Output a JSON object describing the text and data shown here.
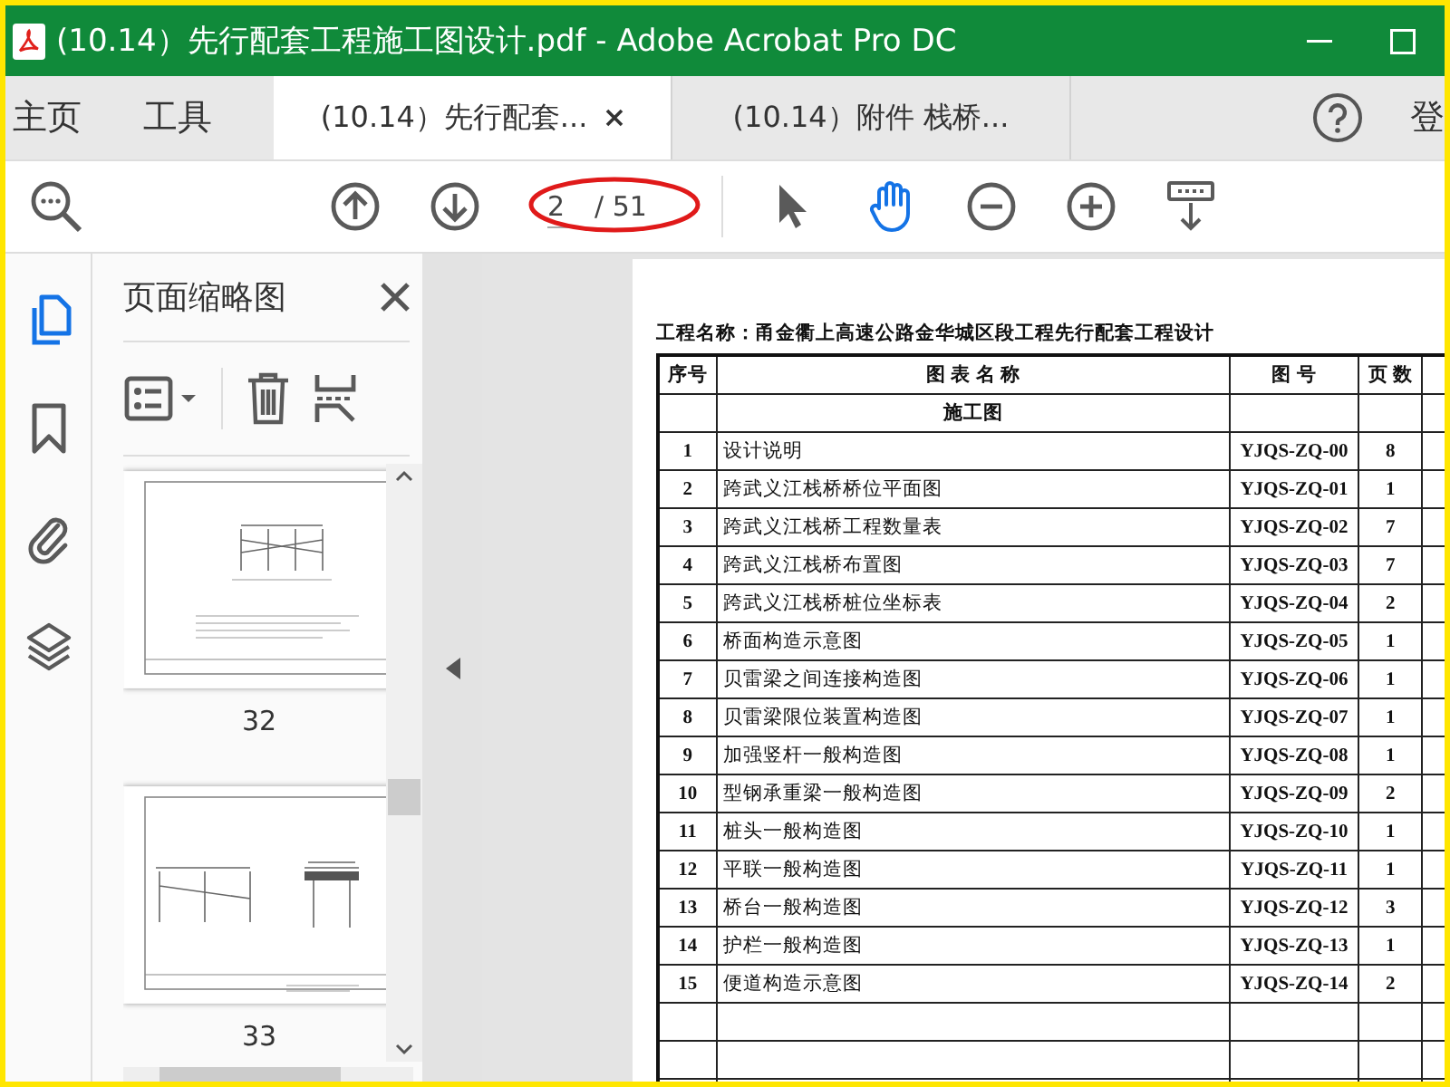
{
  "window": {
    "title": "(10.14）先行配套工程施工图设计.pdf - Adobe Acrobat Pro DC"
  },
  "nav_tabs": [
    {
      "label": "主页"
    },
    {
      "label": "工具"
    }
  ],
  "doc_tabs": [
    {
      "label": "(10.14）先行配套...",
      "selected": true
    },
    {
      "label": "(10.14）附件 栈桥...",
      "selected": false
    }
  ],
  "account_label": "登",
  "toolbar": {
    "page_value": "2",
    "page_total": "/ 51",
    "tools": [
      {
        "kind": "pointer",
        "selected": false
      },
      {
        "kind": "hand",
        "selected": true
      },
      {
        "kind": "zoom-out",
        "selected": false
      },
      {
        "kind": "zoom-in",
        "selected": false
      },
      {
        "kind": "keyboard",
        "selected": false
      }
    ]
  },
  "rail": [
    {
      "kind": "pages",
      "selected": true
    },
    {
      "kind": "bookmark",
      "selected": false
    },
    {
      "kind": "attachment",
      "selected": false
    },
    {
      "kind": "layers",
      "selected": false
    }
  ],
  "thumbnails": {
    "title": "页面缩略图",
    "pages": [
      {
        "label": "32"
      },
      {
        "label": "33"
      }
    ]
  },
  "document": {
    "project": "工程名称：甬金衢上高速公路金华城区段工程先行配套工程设计",
    "columns": [
      "序号",
      "图 表 名 称",
      "图 号",
      "页 数"
    ],
    "section": "施工图",
    "rows": [
      {
        "no": "1",
        "name": "设计说明",
        "code": "YJQS-ZQ-00",
        "pages": "8"
      },
      {
        "no": "2",
        "name": "跨武义江栈桥桥位平面图",
        "code": "YJQS-ZQ-01",
        "pages": "1"
      },
      {
        "no": "3",
        "name": "跨武义江栈桥工程数量表",
        "code": "YJQS-ZQ-02",
        "pages": "7"
      },
      {
        "no": "4",
        "name": "跨武义江栈桥布置图",
        "code": "YJQS-ZQ-03",
        "pages": "7"
      },
      {
        "no": "5",
        "name": "跨武义江栈桥桩位坐标表",
        "code": "YJQS-ZQ-04",
        "pages": "2"
      },
      {
        "no": "6",
        "name": "桥面构造示意图",
        "code": "YJQS-ZQ-05",
        "pages": "1"
      },
      {
        "no": "7",
        "name": "贝雷梁之间连接构造图",
        "code": "YJQS-ZQ-06",
        "pages": "1"
      },
      {
        "no": "8",
        "name": "贝雷梁限位装置构造图",
        "code": "YJQS-ZQ-07",
        "pages": "1"
      },
      {
        "no": "9",
        "name": "加强竖杆一般构造图",
        "code": "YJQS-ZQ-08",
        "pages": "1"
      },
      {
        "no": "10",
        "name": "型钢承重梁一般构造图",
        "code": "YJQS-ZQ-09",
        "pages": "2"
      },
      {
        "no": "11",
        "name": "桩头一般构造图",
        "code": "YJQS-ZQ-10",
        "pages": "1"
      },
      {
        "no": "12",
        "name": "平联一般构造图",
        "code": "YJQS-ZQ-11",
        "pages": "1"
      },
      {
        "no": "13",
        "name": "桥台一般构造图",
        "code": "YJQS-ZQ-12",
        "pages": "3"
      },
      {
        "no": "14",
        "name": "护栏一般构造图",
        "code": "YJQS-ZQ-13",
        "pages": "1"
      },
      {
        "no": "15",
        "name": "便道构造示意图",
        "code": "YJQS-ZQ-14",
        "pages": "2"
      }
    ]
  }
}
